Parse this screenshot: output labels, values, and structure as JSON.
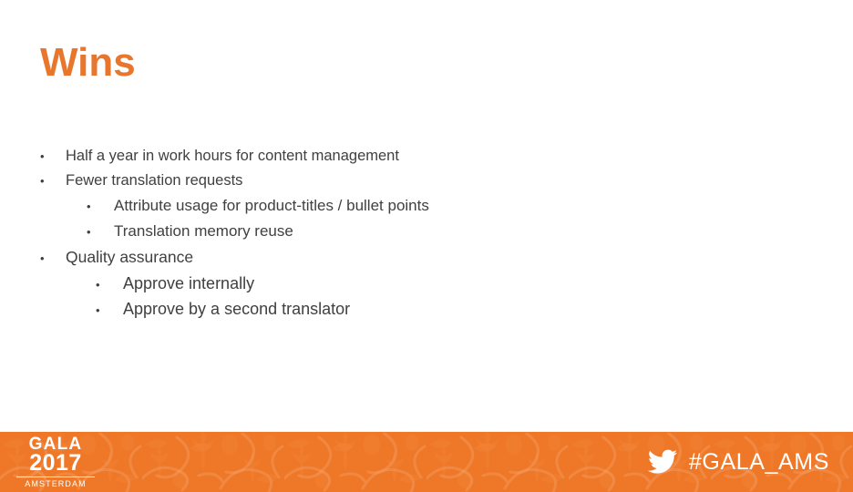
{
  "slide": {
    "title": "Wins",
    "title_color": "#E8762C",
    "background_color": "#FFFFFF",
    "body_text_color": "#404040"
  },
  "bullets": [
    {
      "level": 1,
      "marker": "•",
      "text": "Half a year in work hours for content management"
    },
    {
      "level": 1,
      "marker": "•",
      "text": "Fewer translation requests"
    },
    {
      "level": 2,
      "marker": "•",
      "text": "Attribute usage for product-titles / bullet points"
    },
    {
      "level": 2,
      "marker": "•",
      "text": "Translation memory reuse"
    },
    {
      "level": 1,
      "marker": "•",
      "text": "Quality assurance"
    },
    {
      "level": 2,
      "marker": "•",
      "text": "Approve internally"
    },
    {
      "level": 2,
      "marker": "•",
      "text": "Approve by a second translator"
    }
  ],
  "footer": {
    "background_color": "#EF7828",
    "pattern_name": "tulip-floral-pattern",
    "logo": {
      "name": "GALA",
      "year": "2017",
      "city": "AMSTERDAM"
    },
    "twitter": {
      "icon": "twitter-bird-icon",
      "handle": "#GALA_AMS"
    }
  }
}
